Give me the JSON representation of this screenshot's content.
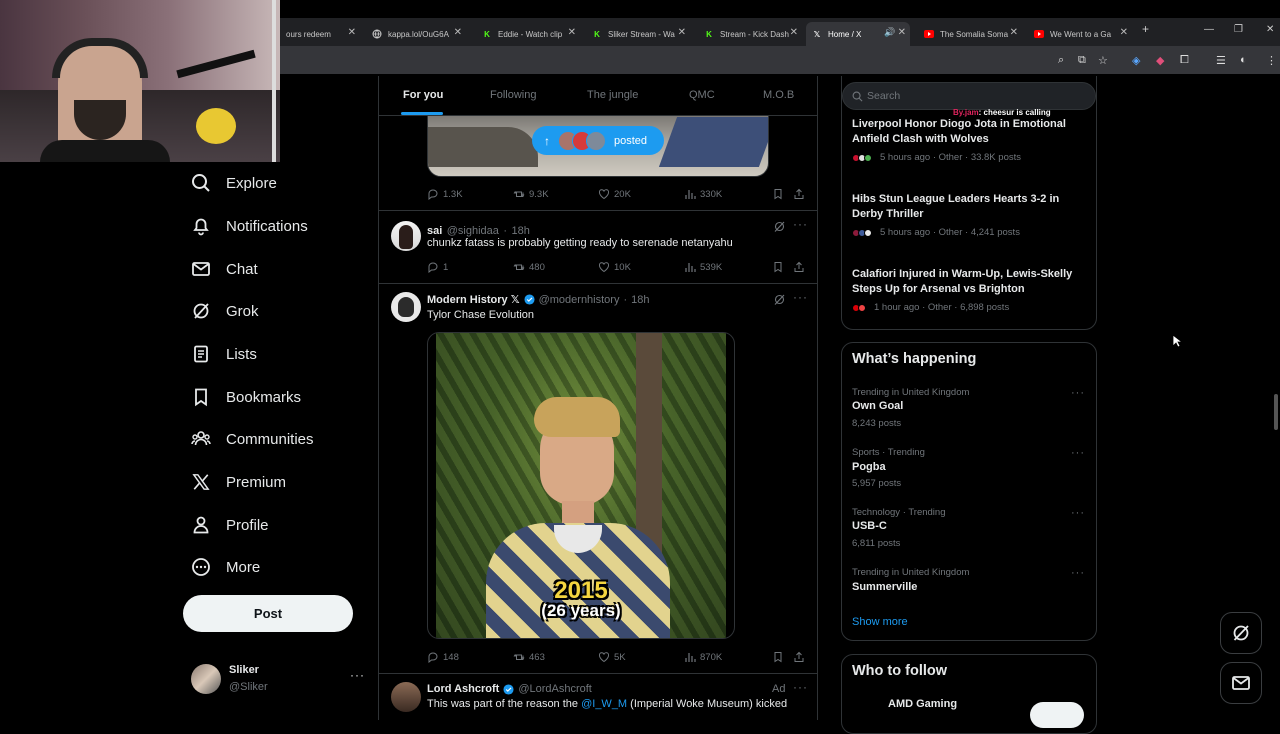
{
  "browser": {
    "tabs": [
      {
        "label": "ours redeem",
        "icon": "blank-tab-icon",
        "active": false
      },
      {
        "label": "kappa.lol/OuG6A",
        "icon": "globe-icon",
        "active": false
      },
      {
        "label": "Eddie - Watch clip",
        "icon": "kick-icon",
        "active": false
      },
      {
        "label": "Sliker Stream - Wa",
        "icon": "kick-icon",
        "active": false
      },
      {
        "label": "Stream - Kick Dash",
        "icon": "kick-icon",
        "active": false
      },
      {
        "label": "Home / X",
        "icon": "x-icon",
        "active": true
      },
      {
        "label": "The Somalia Soma",
        "icon": "youtube-icon",
        "active": false
      },
      {
        "label": "We Went to a Ga",
        "icon": "youtube-icon",
        "active": false
      }
    ],
    "new_tab": "+"
  },
  "nav": {
    "items": [
      {
        "label": "Explore",
        "icon": "search-icon"
      },
      {
        "label": "Notifications",
        "icon": "bell-icon"
      },
      {
        "label": "Chat",
        "icon": "mail-icon"
      },
      {
        "label": "Grok",
        "icon": "grok-icon"
      },
      {
        "label": "Lists",
        "icon": "list-icon"
      },
      {
        "label": "Bookmarks",
        "icon": "bookmark-icon"
      },
      {
        "label": "Communities",
        "icon": "communities-icon"
      },
      {
        "label": "Premium",
        "icon": "x-logo-icon"
      },
      {
        "label": "Profile",
        "icon": "person-icon"
      },
      {
        "label": "More",
        "icon": "more-circle-icon"
      }
    ],
    "post_label": "Post",
    "account": {
      "name": "Sliker",
      "handle": "@Sliker"
    }
  },
  "timeline": {
    "tabs": [
      "For you",
      "Following",
      "The jungle",
      "QMC",
      "M.O.B"
    ],
    "posted_pill": "posted",
    "tweet0_actions": {
      "replies": "1.3K",
      "reposts": "9.3K",
      "likes": "20K",
      "views": "330K"
    },
    "tweet1": {
      "name": "sai",
      "handle": "@sighidaa",
      "time": "18h",
      "text": "chunkz fatass is probably getting ready to serenade netanyahu",
      "replies": "1",
      "reposts": "480",
      "likes": "10K",
      "views": "539K"
    },
    "tweet2": {
      "name": "Modern History 𝕏",
      "handle": "@modernhistory",
      "time": "18h",
      "text": "Tylor Chase Evolution",
      "caption_year": "2015",
      "caption_age": "(26 years)",
      "replies": "148",
      "reposts": "463",
      "likes": "5K",
      "views": "870K"
    },
    "tweet3": {
      "name": "Lord Ashcroft",
      "handle": "@LordAshcroft",
      "ad": "Ad",
      "text_before": "This was part of the reason the ",
      "link": "@I_W_M",
      "text_after": " (Imperial Woke Museum) kicked"
    }
  },
  "right": {
    "search_placeholder": "Search",
    "overlay_user": "By.jam",
    "overlay_text": ": cheesur is calling",
    "news": [
      {
        "title": "Liverpool Honor Diogo Jota in Emotional Anfield Clash with Wolves",
        "meta": "5 hours ago · Other · 33.8K posts"
      },
      {
        "title": "Hibs Stun League Leaders Hearts 3-2 in Derby Thriller",
        "meta": "5 hours ago · Other · 4,241 posts"
      },
      {
        "title": "Calafiori Injured in Warm-Up, Lewis-Skelly Steps Up for Arsenal vs Brighton",
        "meta": "1 hour ago · Other · 6,898 posts"
      }
    ],
    "happening_title": "What’s happening",
    "trends": [
      {
        "category": "Trending in United Kingdom",
        "name": "Own Goal",
        "posts": "8,243 posts"
      },
      {
        "category": "Sports · Trending",
        "name": "Pogba",
        "posts": "5,957 posts"
      },
      {
        "category": "Technology · Trending",
        "name": "USB-C",
        "posts": "6,811 posts"
      },
      {
        "category": "Trending in United Kingdom",
        "name": "Summerville",
        "posts": ""
      }
    ],
    "show_more": "Show more",
    "who_to_follow": "Who to follow",
    "follow_suggestion": "AMD Gaming"
  },
  "colors": {
    "accent": "#1d9bf0",
    "background": "#000000",
    "border": "#2f3336",
    "muted": "#71767b",
    "text": "#e7e9ea"
  }
}
